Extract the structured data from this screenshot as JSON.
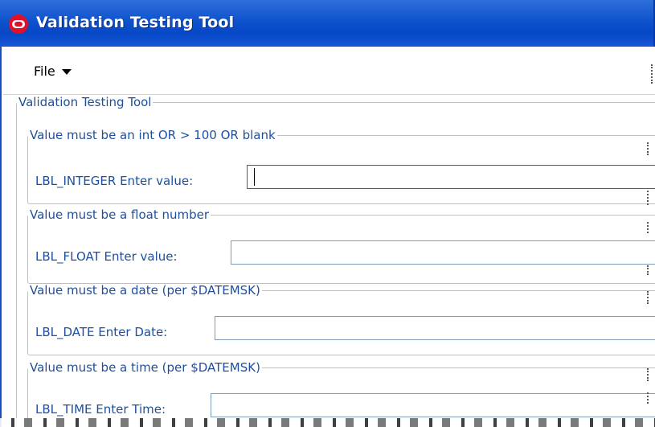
{
  "window": {
    "title": "Validation Testing Tool"
  },
  "menu": {
    "file_label": "File"
  },
  "main_group": {
    "legend": "Validation Testing Tool"
  },
  "fields": [
    {
      "legend": "Value must be an int OR > 100 OR blank",
      "label": "LBL_INTEGER Enter value:",
      "value": ""
    },
    {
      "legend": "Value must be a float number",
      "label": "LBL_FLOAT Enter value:",
      "value": ""
    },
    {
      "legend": "Value must be a date (per $DATEMSK)",
      "label": "LBL_DATE Enter Date:",
      "value": ""
    },
    {
      "legend": "Value must be a time (per $DATEMSK)",
      "label": "LBL_TIME Enter Time:",
      "value": ""
    }
  ],
  "colors": {
    "titlebar": "#0648c6",
    "label_text": "#1f4f9c",
    "border": "#bfbfbf"
  },
  "icons": {
    "app_icon": "oracle-logo-icon",
    "menu_caret": "caret-down-icon"
  }
}
